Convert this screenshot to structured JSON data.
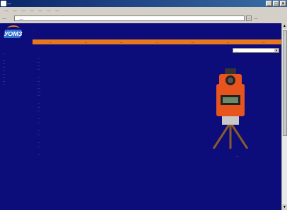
{
  "window": {
    "title": "…",
    "buttons": [
      "_",
      "□",
      "×"
    ]
  },
  "menubar": {
    "items": [
      "…",
      "…",
      "…",
      "…",
      "…",
      "…",
      "…"
    ]
  },
  "addressbar": {
    "label": "…",
    "url": "…",
    "go_label": "→",
    "links_label": "…"
  },
  "site": {
    "logo_text": "УОМЗ",
    "tagline": "…",
    "nav": [
      "…",
      "…",
      "…",
      "…",
      "…",
      "…",
      "…"
    ],
    "select_value": "…"
  },
  "sidebar": {
    "items": [
      "…",
      "…",
      "…",
      "…",
      "…",
      "…",
      "…",
      "…",
      "…"
    ]
  },
  "content": {
    "sections": [
      {
        "heading": "…",
        "lines": [
          "…",
          "…",
          "…"
        ]
      },
      {
        "heading": "…",
        "lines": [
          "…",
          "…",
          "…",
          "…",
          "…"
        ]
      },
      {
        "heading": "…",
        "lines": [
          "…",
          "…"
        ]
      },
      {
        "heading": "…",
        "lines": [
          "…"
        ]
      },
      {
        "heading": "…",
        "lines": [
          "…"
        ]
      },
      {
        "heading": "…",
        "lines": [
          "…"
        ]
      },
      {
        "heading": "…",
        "lines": []
      }
    ]
  },
  "product": {
    "caption": "…"
  },
  "colors": {
    "page_bg": "#0c0c7a",
    "accent": "#e8781e",
    "heading": "#ff9c2a"
  }
}
